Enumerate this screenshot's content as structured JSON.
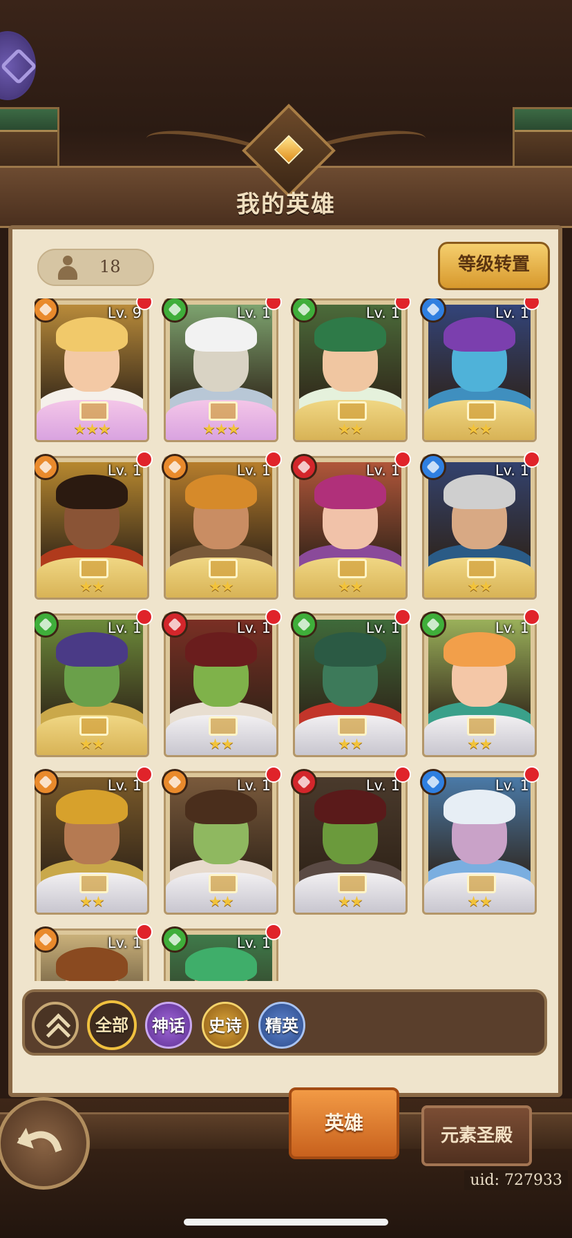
{
  "header": {
    "title": "我的英雄"
  },
  "toolbar": {
    "hero_count": "18",
    "level_transfer_label": "等级转置"
  },
  "colors": {
    "fire": "#e98a2c",
    "wind": "#3fae3a",
    "water": "#2f7fe0",
    "blood": "#d3262b"
  },
  "heroes": [
    {
      "level": "Lv. 9",
      "stars": "★★★",
      "element": "fire",
      "frame": "pink",
      "skin": "#f3c9a5",
      "hair": "#f1c96a",
      "bg": "#b98b3a",
      "cloth": "#f5f0ea"
    },
    {
      "level": "Lv. 1",
      "stars": "★★★",
      "element": "wind",
      "frame": "pink",
      "skin": "#d9d3c4",
      "hair": "#f2f2f2",
      "bg": "#7da36f",
      "cloth": "#b8c7d6"
    },
    {
      "level": "Lv. 1",
      "stars": "★★",
      "element": "wind",
      "frame": "gold",
      "skin": "#f0c6a1",
      "hair": "#2e7a48",
      "bg": "#4b6b3a",
      "cloth": "#e5f1dc"
    },
    {
      "level": "Lv. 1",
      "stars": "★★",
      "element": "water",
      "frame": "gold",
      "skin": "#4fb2d9",
      "hair": "#7b3fae",
      "bg": "#33447a",
      "cloth": "#3f8fbf"
    },
    {
      "level": "Lv. 1",
      "stars": "★★",
      "element": "fire",
      "frame": "gold",
      "skin": "#8a5436",
      "hair": "#2b1a10",
      "bg": "#b7882f",
      "cloth": "#b03a1c"
    },
    {
      "level": "Lv. 1",
      "stars": "★★",
      "element": "fire",
      "frame": "gold",
      "skin": "#c98d63",
      "hair": "#d68a2a",
      "bg": "#b77e2c",
      "cloth": "#7a5a3a"
    },
    {
      "level": "Lv. 1",
      "stars": "★★",
      "element": "blood",
      "frame": "gold",
      "skin": "#f1c2a9",
      "hair": "#b0307a",
      "bg": "#b0563a",
      "cloth": "#8a4a9a"
    },
    {
      "level": "Lv. 1",
      "stars": "★★",
      "element": "water",
      "frame": "gold",
      "skin": "#d8a984",
      "hair": "#cfcfcf",
      "bg": "#33426e",
      "cloth": "#2a5b86"
    },
    {
      "level": "Lv. 1",
      "stars": "★★",
      "element": "wind",
      "frame": "gold",
      "skin": "#6aa04a",
      "hair": "#4a3a86",
      "bg": "#6c8a3a",
      "cloth": "#caa84a"
    },
    {
      "level": "Lv. 1",
      "stars": "★★",
      "element": "blood",
      "frame": "silver",
      "skin": "#7fb24a",
      "hair": "#6a1d1d",
      "bg": "#7a2f24",
      "cloth": "#e8ded0"
    },
    {
      "level": "Lv. 1",
      "stars": "★★",
      "element": "wind",
      "frame": "silver",
      "skin": "#3d7a5a",
      "hair": "#2b5a44",
      "bg": "#3f6a3a",
      "cloth": "#c2352a"
    },
    {
      "level": "Lv. 1",
      "stars": "★★",
      "element": "wind",
      "frame": "silver",
      "skin": "#f4c7a7",
      "hair": "#f29f4a",
      "bg": "#9ab05a",
      "cloth": "#3aa08a"
    },
    {
      "level": "Lv. 1",
      "stars": "★★",
      "element": "fire",
      "frame": "silver",
      "skin": "#b57a52",
      "hair": "#d7a12c",
      "bg": "#7a5a2a",
      "cloth": "#c9a84a"
    },
    {
      "level": "Lv. 1",
      "stars": "★★",
      "element": "fire",
      "frame": "silver",
      "skin": "#8fb860",
      "hair": "#4a2e1c",
      "bg": "#7a5a3c",
      "cloth": "#e7dacc"
    },
    {
      "level": "Lv. 1",
      "stars": "★★",
      "element": "blood",
      "frame": "silver",
      "skin": "#6b9a3c",
      "hair": "#5a1a1a",
      "bg": "#4a3a2c",
      "cloth": "#5a4a44"
    },
    {
      "level": "Lv. 1",
      "stars": "★★",
      "element": "water",
      "frame": "silver",
      "skin": "#c9a2c8",
      "hair": "#e7eef5",
      "bg": "#4a7aa8",
      "cloth": "#7aaee0"
    },
    {
      "level": "Lv. 1",
      "stars": "",
      "element": "fire",
      "frame": "gold",
      "skin": "#e0ad8a",
      "hair": "#8a4a20",
      "bg": "#c9b07a",
      "cloth": "#e7e7e7"
    },
    {
      "level": "Lv. 1",
      "stars": "",
      "element": "wind",
      "frame": "gold",
      "skin": "#d8a37c",
      "hair": "#3fae6a",
      "bg": "#3f7a4a",
      "cloth": "#6a9a3a"
    }
  ],
  "filters": {
    "all": "全部",
    "myth": "神话",
    "epic": "史诗",
    "elite": "精英"
  },
  "tabs": {
    "heroes": "英雄",
    "element_temple": "元素圣殿"
  },
  "footer": {
    "uid": "uid: 727933"
  }
}
